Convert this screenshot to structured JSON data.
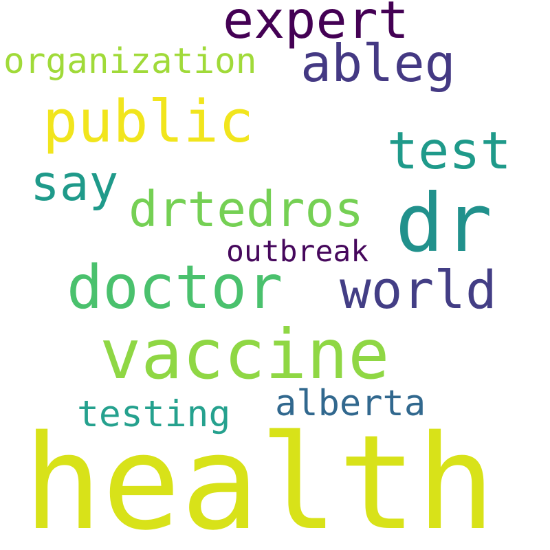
{
  "words": {
    "health": {
      "text": "health",
      "color": "#d8e219"
    },
    "vaccine": {
      "text": "vaccine",
      "color": "#8fd744"
    },
    "doctor": {
      "text": "doctor",
      "color": "#4ac16d"
    },
    "dr": {
      "text": "dr",
      "color": "#21918c"
    },
    "public": {
      "text": "public",
      "color": "#f1e51d"
    },
    "drtedros": {
      "text": "drtedros",
      "color": "#75d054"
    },
    "world": {
      "text": "world",
      "color": "#433e85"
    },
    "expert": {
      "text": "expert",
      "color": "#440154"
    },
    "ableg": {
      "text": "ableg",
      "color": "#443983"
    },
    "test": {
      "text": "test",
      "color": "#1f9a8a"
    },
    "say": {
      "text": "say",
      "color": "#1f9a8a"
    },
    "organization": {
      "text": "organization",
      "color": "#a0da39"
    },
    "testing": {
      "text": "testing",
      "color": "#25a18e"
    },
    "alberta": {
      "text": "alberta",
      "color": "#31688e"
    },
    "outbreak": {
      "text": "outbreak",
      "color": "#46085c"
    }
  },
  "background_color": "#ffffff"
}
